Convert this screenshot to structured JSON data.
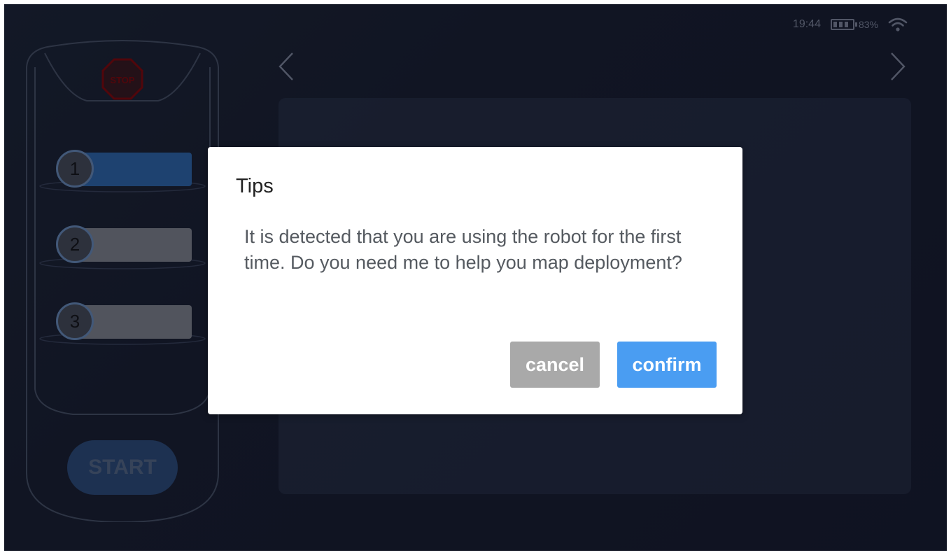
{
  "status_bar": {
    "time": "19:44",
    "battery_percent": "83%",
    "battery_level": 0.83
  },
  "remote": {
    "stop_label": "STOP",
    "steps": [
      {
        "number": "1",
        "active": true
      },
      {
        "number": "2",
        "active": false
      },
      {
        "number": "3",
        "active": false
      }
    ],
    "start_label": "START"
  },
  "dialog": {
    "title": "Tips",
    "message": "It is detected that you are using the robot for the first time. Do you need me to help you map deployment?",
    "cancel_label": "cancel",
    "confirm_label": "confirm"
  },
  "colors": {
    "active_step": "#2f6db8",
    "inactive_step": "#8a8f96",
    "confirm": "#4a9df2",
    "cancel": "#a9a9a9",
    "stop": "#8b0000"
  }
}
